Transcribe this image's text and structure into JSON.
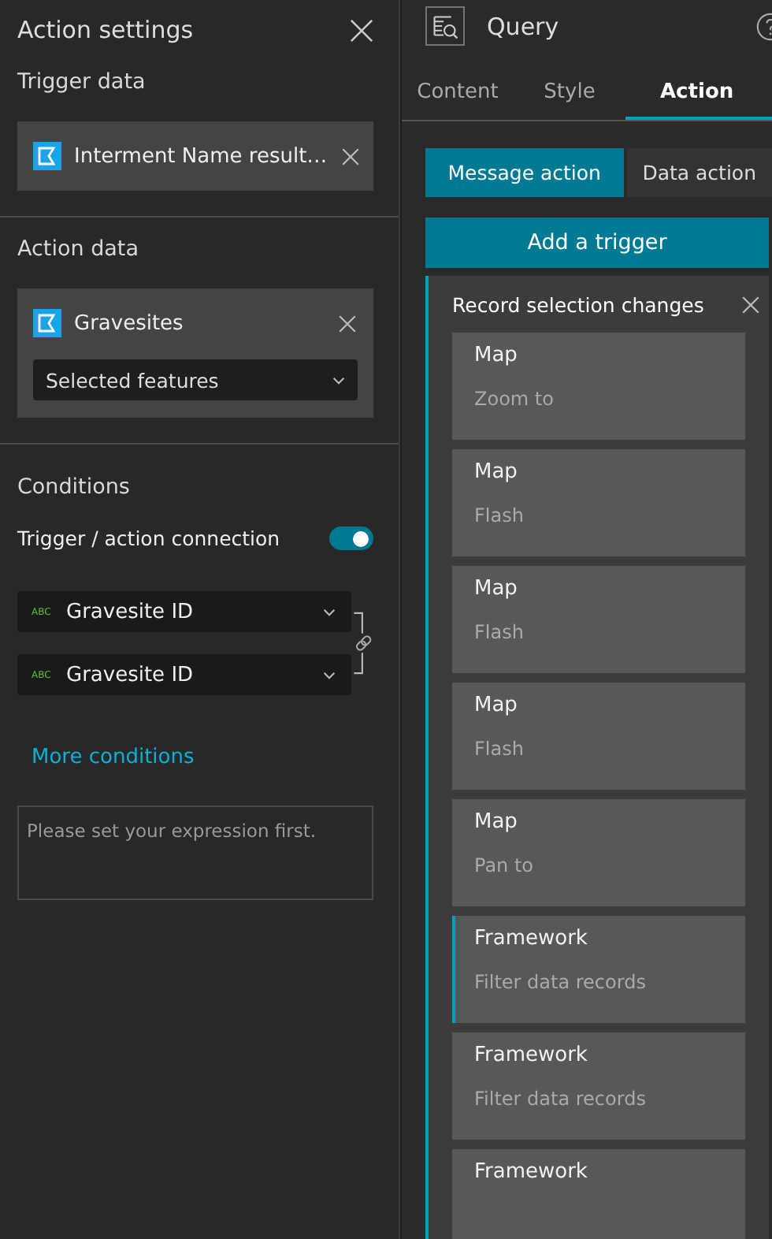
{
  "left_panel": {
    "title": "Action settings",
    "trigger_data": {
      "heading": "Trigger data",
      "source": "Interment Name result…"
    },
    "action_data": {
      "heading": "Action data",
      "source": "Gravesites",
      "dropdown": "Selected features"
    },
    "conditions": {
      "heading": "Conditions",
      "connection_label": "Trigger / action connection",
      "connection_on": true,
      "fields": [
        {
          "type_tag": "ABC",
          "name": "Gravesite ID"
        },
        {
          "type_tag": "ABC",
          "name": "Gravesite ID"
        }
      ],
      "more_link": "More conditions",
      "expression_placeholder": "Please set your expression first."
    }
  },
  "right_panel": {
    "title": "Query",
    "tabs": [
      {
        "label": "Content",
        "selected": false
      },
      {
        "label": "Style",
        "selected": false
      },
      {
        "label": "Action",
        "selected": true
      }
    ],
    "mode_buttons": [
      {
        "label": "Message action",
        "selected": true
      },
      {
        "label": "Data action",
        "selected": false
      }
    ],
    "add_button": "Add a trigger",
    "trigger": {
      "title": "Record selection changes",
      "actions": [
        {
          "target": "Map",
          "action": "Zoom to",
          "selected": false
        },
        {
          "target": "Map",
          "action": "Flash",
          "selected": false
        },
        {
          "target": "Map",
          "action": "Flash",
          "selected": false
        },
        {
          "target": "Map",
          "action": "Flash",
          "selected": false
        },
        {
          "target": "Map",
          "action": "Pan to",
          "selected": false
        },
        {
          "target": "Framework",
          "action": "Filter data records",
          "selected": true
        },
        {
          "target": "Framework",
          "action": "Filter data records",
          "selected": false
        },
        {
          "target": "Framework",
          "selected": false
        }
      ]
    }
  }
}
